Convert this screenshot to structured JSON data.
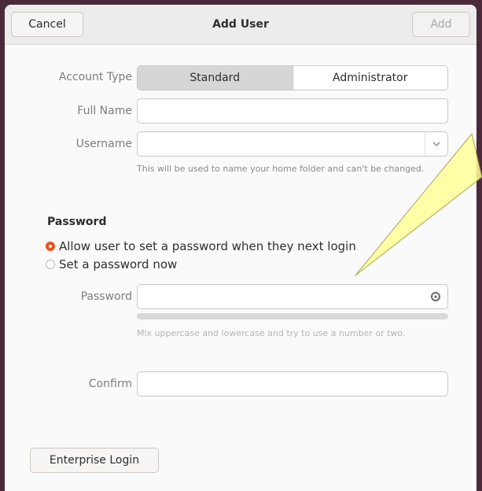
{
  "header": {
    "cancel_label": "Cancel",
    "title": "Add User",
    "add_label": "Add"
  },
  "account_type": {
    "label": "Account Type",
    "options": [
      "Standard",
      "Administrator"
    ],
    "selected": "Standard"
  },
  "full_name": {
    "label": "Full Name",
    "value": ""
  },
  "username": {
    "label": "Username",
    "value": "",
    "hint": "This will be used to name your home folder and can't be changed."
  },
  "password_section": {
    "title": "Password",
    "option_next_login": "Allow user to set a password when they next login",
    "option_now": "Set a password now",
    "selected": "option_next_login"
  },
  "password": {
    "label": "Password",
    "value": "",
    "hint": "Mix uppercase and lowercase and try to use a number or two.",
    "strength": 0
  },
  "confirm": {
    "label": "Confirm",
    "value": ""
  },
  "footer": {
    "enterprise_label": "Enterprise Login"
  },
  "colors": {
    "accent": "#e95420",
    "annotation_fill": "#ffff99"
  },
  "icons": {
    "dropdown": "chevron-down-icon",
    "password_peek": "peek-icon"
  }
}
